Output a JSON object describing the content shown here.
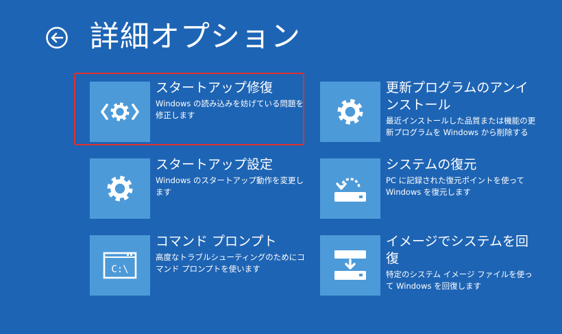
{
  "header": {
    "title": "詳細オプション"
  },
  "options": [
    {
      "title": "スタートアップ修復",
      "description": "Windows の読み込みを妨げている問題を修正します",
      "icon": "startup-repair-gear-icon",
      "selected": true
    },
    {
      "title": "更新プログラムのアンインストール",
      "description": "最近インストールした品質または機能の更新プログラムを Windows から削除する",
      "icon": "gear-icon",
      "selected": false
    },
    {
      "title": "スタートアップ設定",
      "description": "Windows のスタートアップ動作を変更します",
      "icon": "gear-icon",
      "selected": false
    },
    {
      "title": "システムの復元",
      "description": "PC に記録された復元ポイントを使って Windows を復元します",
      "icon": "system-restore-icon",
      "selected": false
    },
    {
      "title": "コマンド プロンプト",
      "description": "高度なトラブルシューティングのためにコマンド プロンプトを使います",
      "icon": "command-prompt-icon",
      "command_prompt_glyph": "C:\\",
      "selected": false
    },
    {
      "title": "イメージでシステムを回復",
      "description": "特定のシステム イメージ ファイルを使って Windows を回復します",
      "icon": "system-image-recovery-icon",
      "selected": false
    }
  ],
  "colors": {
    "background": "#1e64b4",
    "tile": "#4d9ad9",
    "selection": "#e0302e",
    "text": "#ffffff"
  }
}
